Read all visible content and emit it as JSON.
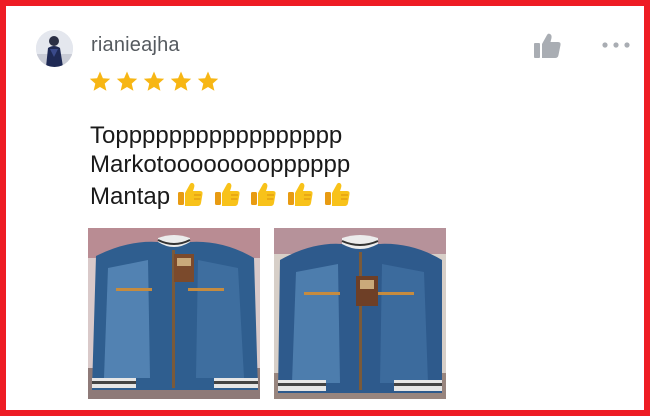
{
  "review": {
    "username": "rianieajha",
    "rating": 5,
    "max_rating": 5,
    "text_lines": [
      "Toppppppppppppppppp",
      "Markotoooooooopppppp",
      "Mantap"
    ],
    "emoji_count": 5
  },
  "icons": {
    "like": "thumbs-up-icon",
    "more": "more-options-icon",
    "star": "star-icon",
    "emoji": "thumbs-up-emoji"
  },
  "colors": {
    "frame": "#ee1c24",
    "star": "#f7b614",
    "username": "#555a5f",
    "icon": "#a9adb3"
  },
  "photos": [
    {
      "subject": "denim-jacket"
    },
    {
      "subject": "denim-jacket"
    }
  ]
}
